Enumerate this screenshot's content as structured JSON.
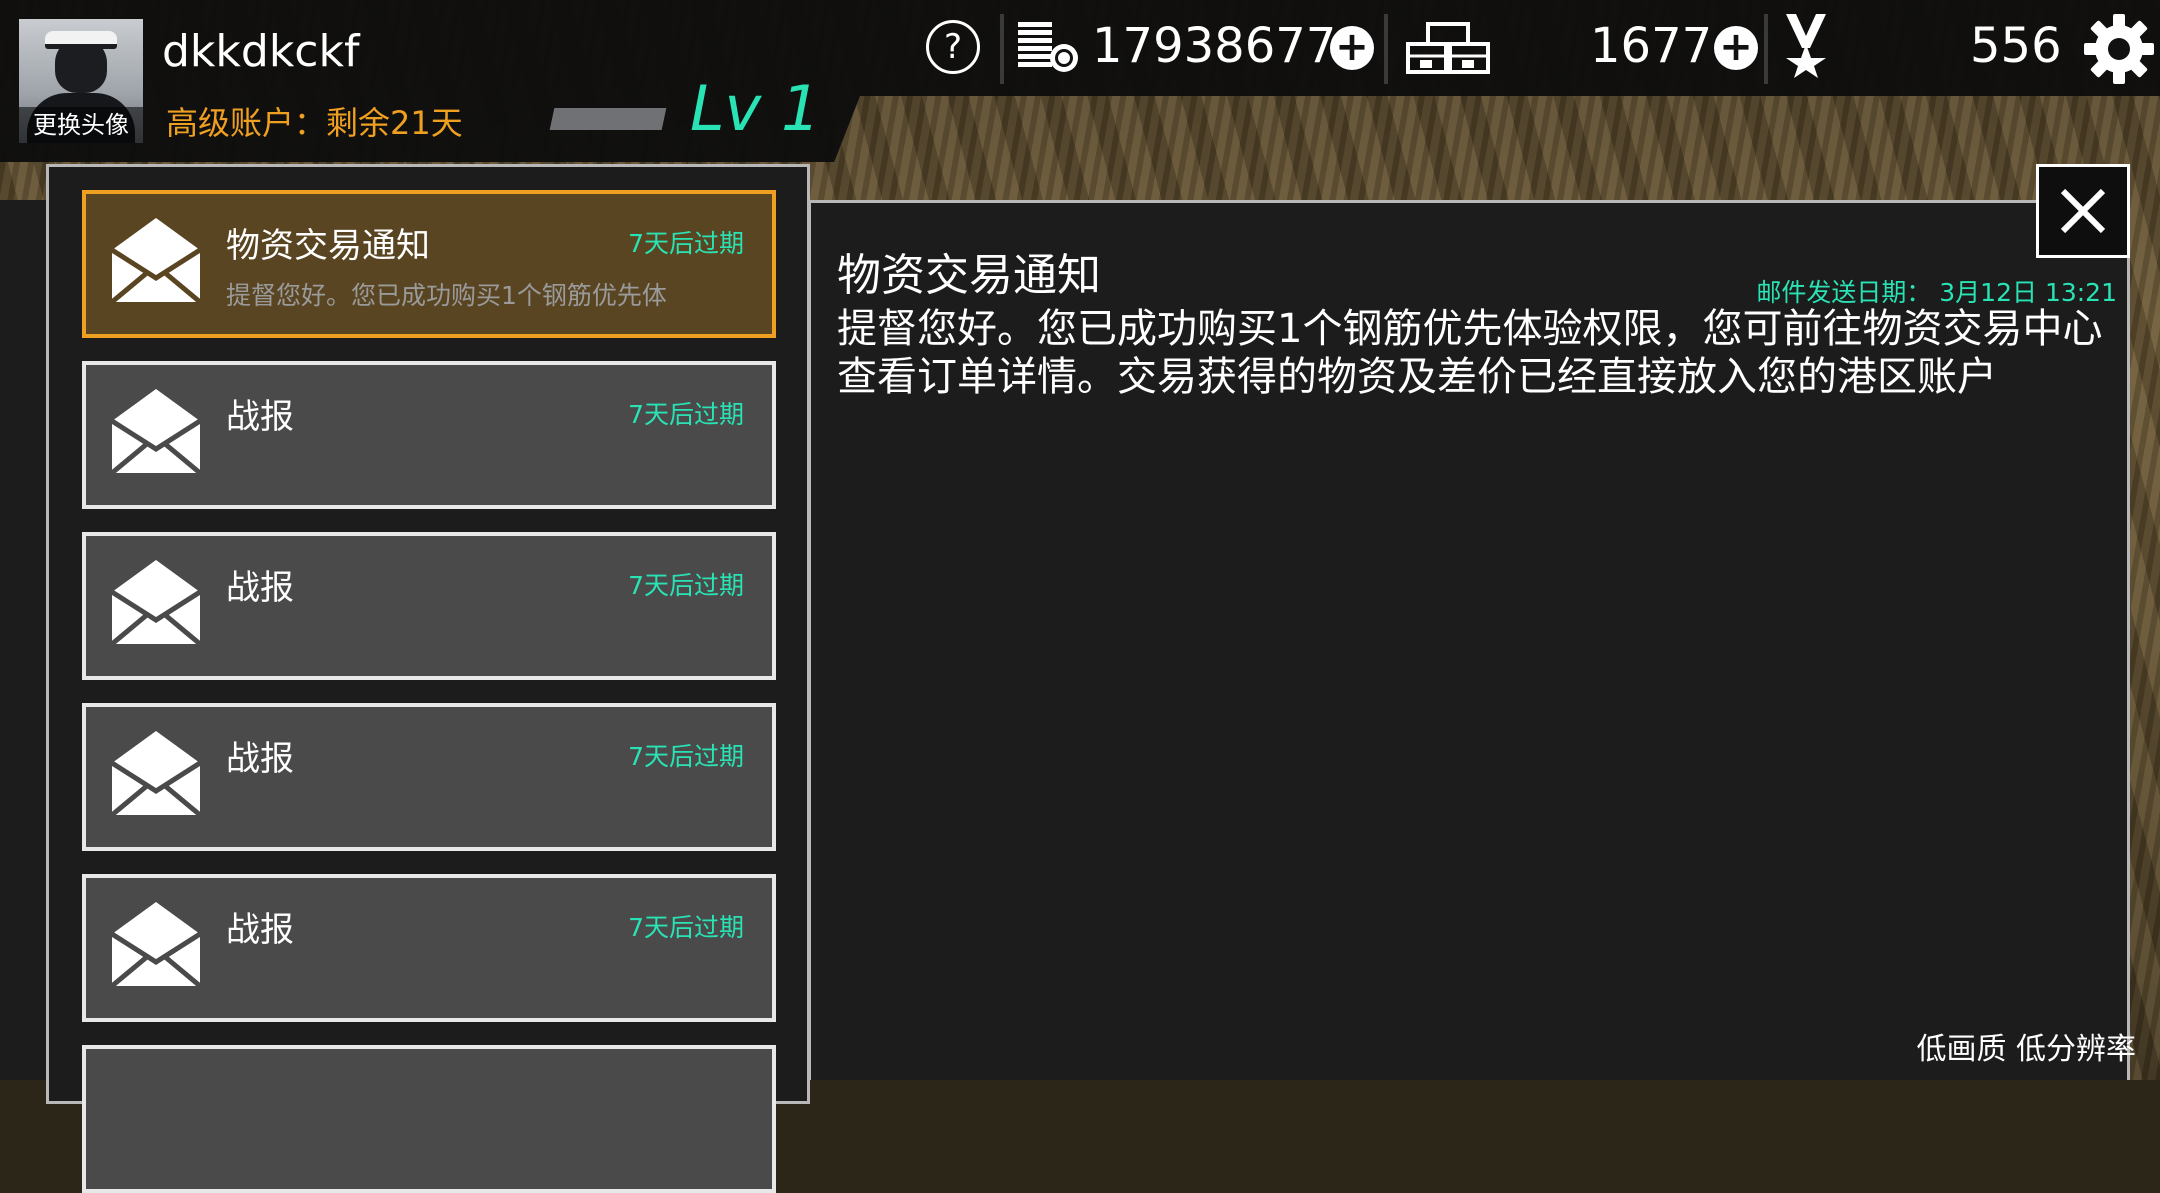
{
  "header": {
    "username": "dkkdkckf",
    "avatar_label": "更换头像",
    "account_status": "高级账户：剩余21天",
    "level": "Lv 1",
    "help_symbol": "?",
    "coins": "17938677",
    "crates": "1677",
    "medals": "556"
  },
  "mail_list": [
    {
      "title": "物资交易通知",
      "expire": "7天后过期",
      "preview": "提督您好。您已成功购买1个钢筋优先体",
      "selected": true
    },
    {
      "title": "战报",
      "expire": "7天后过期",
      "preview": ""
    },
    {
      "title": "战报",
      "expire": "7天后过期",
      "preview": ""
    },
    {
      "title": "战报",
      "expire": "7天后过期",
      "preview": ""
    },
    {
      "title": "战报",
      "expire": "7天后过期",
      "preview": ""
    }
  ],
  "detail": {
    "title": "物资交易通知",
    "date": "邮件发送日期： 3月12日 13:21",
    "body": "提督您好。您已成功购买1个钢筋优先体验权限，您可前往物资交易中心查看订单详情。交易获得的物资及差价已经直接放入您的港区账户"
  },
  "watermark": "低画质 低分辨率",
  "icons": {
    "help": "help-icon",
    "coin": "coin-stack-icon",
    "crate": "crate-icon",
    "medal": "medal-icon",
    "settings": "gear-icon",
    "mail": "envelope-icon",
    "close": "close-icon"
  },
  "colors": {
    "accent": "#29e3b4",
    "premium": "#f0a020",
    "selected_border": "#f0a020"
  }
}
